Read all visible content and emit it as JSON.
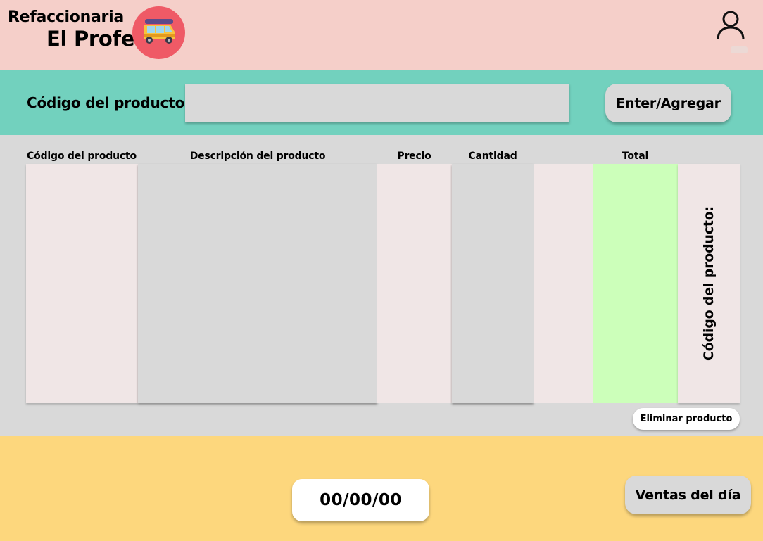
{
  "header": {
    "brand_line1": "Refaccionaria",
    "brand_line2": "El Profe",
    "logo_icon": "auto-rickshaw-icon",
    "user_icon": "user-icon"
  },
  "search": {
    "label": "Código del producto:",
    "value": "",
    "button_label": "Enter/Agregar"
  },
  "table": {
    "columns": [
      "Código del producto",
      "Descripción del producto",
      "Precio",
      "Cantidad",
      "Total"
    ],
    "rows": [],
    "side_label": "Código del producto:"
  },
  "actions": {
    "delete_label": "Eliminar producto"
  },
  "footer": {
    "date": "00/00/00",
    "sales_label": "Ventas del día"
  },
  "colors": {
    "header_bg": "#f5cfc9",
    "search_bg": "#72d1be",
    "main_bg": "#d9d9d9",
    "footer_bg": "#fdd77d",
    "total_column": "#ccffba",
    "logo_bg": "#ef5a66"
  }
}
